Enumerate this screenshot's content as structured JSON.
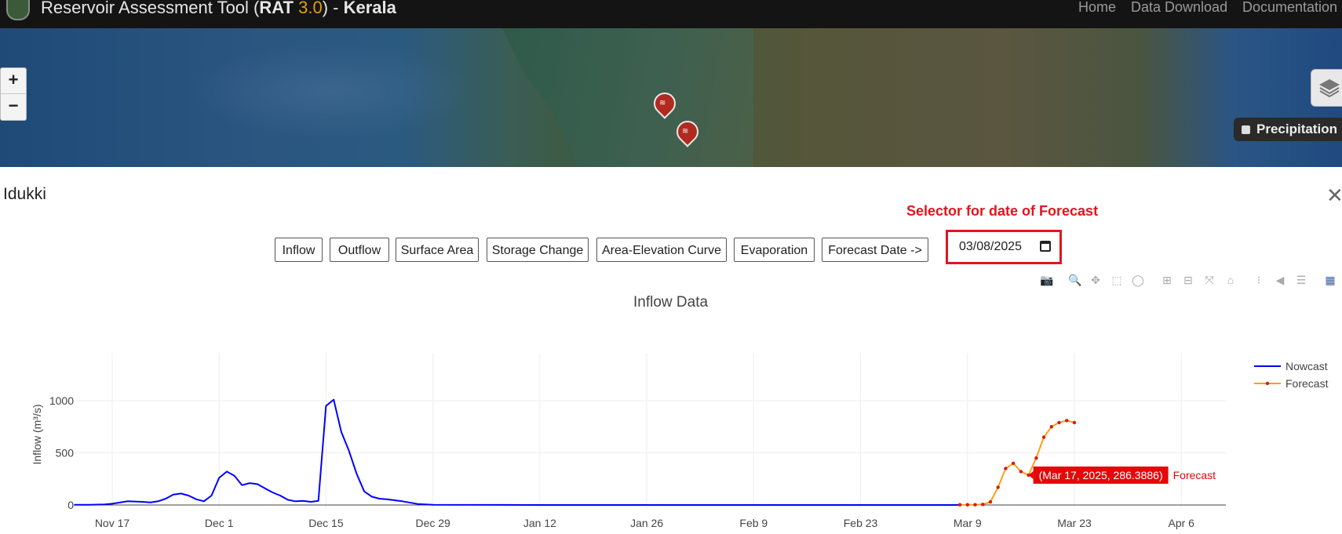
{
  "header": {
    "title_prefix": "Reservoir Assessment Tool (",
    "title_rat": "RAT",
    "title_version": "3.0",
    "title_mid": ") - ",
    "title_region": "Kerala",
    "nav": [
      {
        "label": "Home"
      },
      {
        "label": "Data Download"
      },
      {
        "label": "Documentation"
      }
    ]
  },
  "map": {
    "zoom_in": "+",
    "zoom_out": "−",
    "layer_toggle": "Precipitation"
  },
  "panel": {
    "reservoir_name": "Idukki",
    "annotation": "Selector for date of Forecast",
    "tabs": [
      {
        "label": "Inflow"
      },
      {
        "label": "Outflow"
      },
      {
        "label": "Surface Area"
      },
      {
        "label": "Storage Change"
      },
      {
        "label": "Area-Elevation Curve"
      },
      {
        "label": "Evaporation"
      },
      {
        "label": "Forecast Date ->"
      }
    ],
    "forecast_date": "03/08/2025"
  },
  "modebar": [
    "camera-icon",
    "zoom-icon",
    "pan-icon",
    "box-select-icon",
    "lasso-icon",
    "zoom-in-icon",
    "zoom-out-icon",
    "autoscale-icon",
    "home-icon",
    "spike-icon",
    "hover-closest-icon",
    "hover-compare-icon",
    "plotly-logo-icon"
  ],
  "chart_data": {
    "type": "line",
    "title": "Inflow Data",
    "xlabel": "",
    "ylabel": "Inflow (m³/s)",
    "ylim": [
      -20,
      1150
    ],
    "yticks": [
      0,
      500,
      1000
    ],
    "xticks": [
      "Nov 17",
      "Dec 1",
      "Dec 15",
      "Dec 29",
      "Jan 12",
      "Jan 26",
      "Feb 9",
      "Feb 23",
      "Mar 9",
      "Mar 23",
      "Apr 6"
    ],
    "x_range_start": "Nov 12",
    "grid": true,
    "legend": "top-right",
    "colors": {
      "nowcast": "#0000ff",
      "forecast": "#ff9f10",
      "forecast_marker": "#d81a1a",
      "tooltip_bg": "#e5080b"
    },
    "series": [
      {
        "name": "Nowcast",
        "x": [
          "Nov 12",
          "Nov 14",
          "Nov 16",
          "Nov 17",
          "Nov 19",
          "Nov 21",
          "Nov 22",
          "Nov 23",
          "Nov 24",
          "Nov 25",
          "Nov 26",
          "Nov 27",
          "Nov 28",
          "Nov 29",
          "Nov 30",
          "Dec 1",
          "Dec 2",
          "Dec 3",
          "Dec 4",
          "Dec 5",
          "Dec 6",
          "Dec 7",
          "Dec 8",
          "Dec 9",
          "Dec 10",
          "Dec 11",
          "Dec 12",
          "Dec 13",
          "Dec 14",
          "Dec 15",
          "Dec 16",
          "Dec 17",
          "Dec 18",
          "Dec 19",
          "Dec 20",
          "Dec 21",
          "Dec 22",
          "Dec 23",
          "Dec 25",
          "Dec 27",
          "Dec 29",
          "Jan 12",
          "Jan 26",
          "Feb 9",
          "Feb 23",
          "Mar 8"
        ],
        "y": [
          2,
          2,
          5,
          12,
          35,
          30,
          25,
          35,
          60,
          100,
          110,
          90,
          55,
          35,
          90,
          260,
          320,
          280,
          190,
          210,
          200,
          160,
          120,
          90,
          50,
          35,
          40,
          30,
          40,
          950,
          1010,
          700,
          520,
          300,
          130,
          80,
          60,
          55,
          35,
          10,
          2,
          0,
          0,
          0,
          0,
          0
        ]
      },
      {
        "name": "Forecast",
        "x": [
          "Mar 8",
          "Mar 9",
          "Mar 10",
          "Mar 11",
          "Mar 12",
          "Mar 13",
          "Mar 14",
          "Mar 15",
          "Mar 16",
          "Mar 17",
          "Mar 18",
          "Mar 19",
          "Mar 20",
          "Mar 21",
          "Mar 22",
          "Mar 23"
        ],
        "y": [
          2,
          2,
          2,
          5,
          30,
          170,
          350,
          400,
          320,
          286.3886,
          450,
          650,
          750,
          790,
          810,
          790
        ]
      }
    ],
    "hover": {
      "text": "(Mar 17, 2025, 286.3886)",
      "series": "Forecast"
    }
  }
}
